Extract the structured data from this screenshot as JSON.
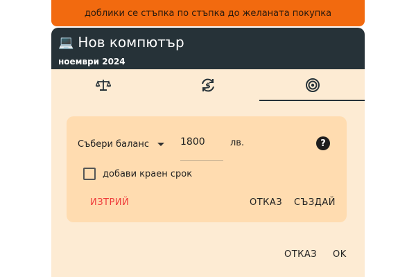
{
  "banner": {
    "text": "доблики се стъпка по стъпка до желаната покупка"
  },
  "dialog": {
    "title_icon": "💻",
    "title": "Нов компютър",
    "subtitle": "ноември 2024"
  },
  "tabs": [
    {
      "icon": "scale-icon",
      "selected": false
    },
    {
      "icon": "currency-exchange-icon",
      "selected": false
    },
    {
      "icon": "target-icon",
      "selected": true
    }
  ],
  "goal": {
    "mode_label": "Събери баланс",
    "amount": "1800",
    "currency": "лв.",
    "help_symbol": "?",
    "deadline_label": "добави краен срок",
    "deadline_checked": false,
    "delete_label": "ИЗТРИЙ",
    "cancel_label": "ОТКАЗ",
    "create_label": "СЪЗДАЙ"
  },
  "footer": {
    "cancel_label": "ОТКАЗ",
    "ok_label": "OK"
  },
  "colors": {
    "banner": "#f26a0f",
    "header": "#263238",
    "dialog_bg": "#fdebd3",
    "card_bg": "#ffdcb0",
    "delete": "#ef3b3b"
  }
}
